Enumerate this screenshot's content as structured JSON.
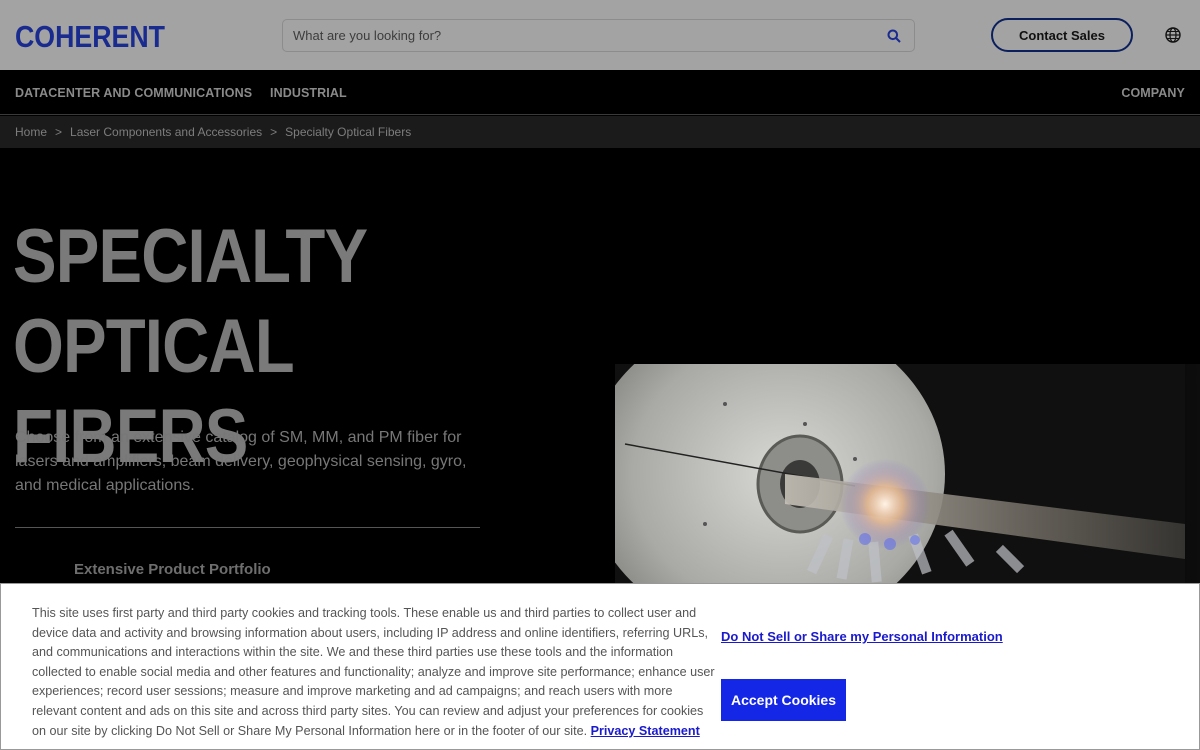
{
  "brand": {
    "logo_text": "COHERENT",
    "accent": "#1a2b8f"
  },
  "search": {
    "placeholder": "What are you looking for?"
  },
  "header": {
    "contact_label": "Contact Sales"
  },
  "nav": {
    "items": [
      "DATACENTER AND COMMUNICATIONS",
      "INDUSTRIAL",
      "COMPANY"
    ]
  },
  "breadcrumb": {
    "items": [
      "Home",
      "Laser Components and Accessories",
      "Specialty Optical Fibers"
    ],
    "separator": ">"
  },
  "hero": {
    "title_line1": "SPECIALTY",
    "title_line2": "OPTICAL FIBERS",
    "description": "Choose from an extensive catalog of SM, MM, and PM fiber for lasers and amplifiers, beam delivery, geophysical sensing, gyro, and medical applications.",
    "feature_title": "Extensive Product Portfolio"
  },
  "cookie": {
    "text": "This site uses first party and third party cookies and tracking tools. These enable us and third parties to collect user and device data and activity and browsing information about users, including IP address and online identifiers, referring URLs, and communications and interactions within the site. We and these third parties use these tools and the information collected to enable social media and other features and functionality; analyze and improve site performance; enhance user experiences; record user sessions; measure and improve marketing and ad campaigns; and reach users with more relevant content and ads on this site and across third party sites. You can review and adjust your preferences for cookies on our site by clicking Do Not Sell or Share My Personal Information here or in the footer of our site.",
    "privacy_label": "Privacy Statement",
    "dns_label": "Do Not Sell or Share my Personal Information",
    "accept_label": "Accept Cookies"
  }
}
